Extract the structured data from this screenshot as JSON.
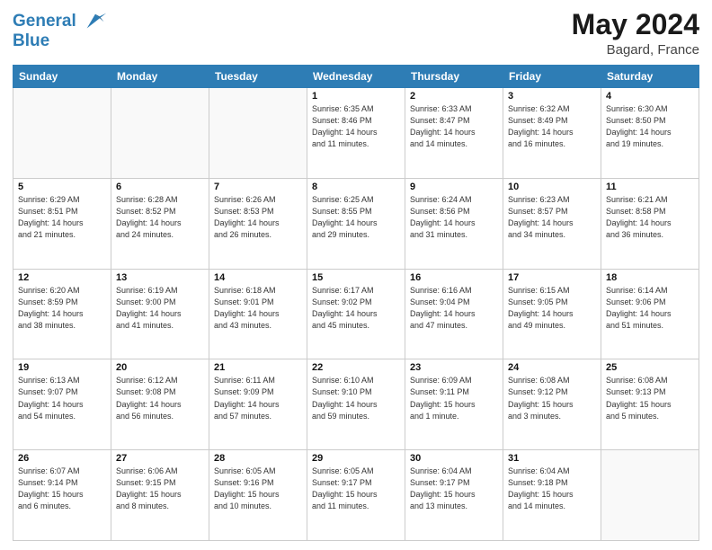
{
  "logo": {
    "line1": "General",
    "line2": "Blue"
  },
  "title": "May 2024",
  "subtitle": "Bagard, France",
  "days_of_week": [
    "Sunday",
    "Monday",
    "Tuesday",
    "Wednesday",
    "Thursday",
    "Friday",
    "Saturday"
  ],
  "weeks": [
    [
      {
        "day": "",
        "info": ""
      },
      {
        "day": "",
        "info": ""
      },
      {
        "day": "",
        "info": ""
      },
      {
        "day": "1",
        "info": "Sunrise: 6:35 AM\nSunset: 8:46 PM\nDaylight: 14 hours\nand 11 minutes."
      },
      {
        "day": "2",
        "info": "Sunrise: 6:33 AM\nSunset: 8:47 PM\nDaylight: 14 hours\nand 14 minutes."
      },
      {
        "day": "3",
        "info": "Sunrise: 6:32 AM\nSunset: 8:49 PM\nDaylight: 14 hours\nand 16 minutes."
      },
      {
        "day": "4",
        "info": "Sunrise: 6:30 AM\nSunset: 8:50 PM\nDaylight: 14 hours\nand 19 minutes."
      }
    ],
    [
      {
        "day": "5",
        "info": "Sunrise: 6:29 AM\nSunset: 8:51 PM\nDaylight: 14 hours\nand 21 minutes."
      },
      {
        "day": "6",
        "info": "Sunrise: 6:28 AM\nSunset: 8:52 PM\nDaylight: 14 hours\nand 24 minutes."
      },
      {
        "day": "7",
        "info": "Sunrise: 6:26 AM\nSunset: 8:53 PM\nDaylight: 14 hours\nand 26 minutes."
      },
      {
        "day": "8",
        "info": "Sunrise: 6:25 AM\nSunset: 8:55 PM\nDaylight: 14 hours\nand 29 minutes."
      },
      {
        "day": "9",
        "info": "Sunrise: 6:24 AM\nSunset: 8:56 PM\nDaylight: 14 hours\nand 31 minutes."
      },
      {
        "day": "10",
        "info": "Sunrise: 6:23 AM\nSunset: 8:57 PM\nDaylight: 14 hours\nand 34 minutes."
      },
      {
        "day": "11",
        "info": "Sunrise: 6:21 AM\nSunset: 8:58 PM\nDaylight: 14 hours\nand 36 minutes."
      }
    ],
    [
      {
        "day": "12",
        "info": "Sunrise: 6:20 AM\nSunset: 8:59 PM\nDaylight: 14 hours\nand 38 minutes."
      },
      {
        "day": "13",
        "info": "Sunrise: 6:19 AM\nSunset: 9:00 PM\nDaylight: 14 hours\nand 41 minutes."
      },
      {
        "day": "14",
        "info": "Sunrise: 6:18 AM\nSunset: 9:01 PM\nDaylight: 14 hours\nand 43 minutes."
      },
      {
        "day": "15",
        "info": "Sunrise: 6:17 AM\nSunset: 9:02 PM\nDaylight: 14 hours\nand 45 minutes."
      },
      {
        "day": "16",
        "info": "Sunrise: 6:16 AM\nSunset: 9:04 PM\nDaylight: 14 hours\nand 47 minutes."
      },
      {
        "day": "17",
        "info": "Sunrise: 6:15 AM\nSunset: 9:05 PM\nDaylight: 14 hours\nand 49 minutes."
      },
      {
        "day": "18",
        "info": "Sunrise: 6:14 AM\nSunset: 9:06 PM\nDaylight: 14 hours\nand 51 minutes."
      }
    ],
    [
      {
        "day": "19",
        "info": "Sunrise: 6:13 AM\nSunset: 9:07 PM\nDaylight: 14 hours\nand 54 minutes."
      },
      {
        "day": "20",
        "info": "Sunrise: 6:12 AM\nSunset: 9:08 PM\nDaylight: 14 hours\nand 56 minutes."
      },
      {
        "day": "21",
        "info": "Sunrise: 6:11 AM\nSunset: 9:09 PM\nDaylight: 14 hours\nand 57 minutes."
      },
      {
        "day": "22",
        "info": "Sunrise: 6:10 AM\nSunset: 9:10 PM\nDaylight: 14 hours\nand 59 minutes."
      },
      {
        "day": "23",
        "info": "Sunrise: 6:09 AM\nSunset: 9:11 PM\nDaylight: 15 hours\nand 1 minute."
      },
      {
        "day": "24",
        "info": "Sunrise: 6:08 AM\nSunset: 9:12 PM\nDaylight: 15 hours\nand 3 minutes."
      },
      {
        "day": "25",
        "info": "Sunrise: 6:08 AM\nSunset: 9:13 PM\nDaylight: 15 hours\nand 5 minutes."
      }
    ],
    [
      {
        "day": "26",
        "info": "Sunrise: 6:07 AM\nSunset: 9:14 PM\nDaylight: 15 hours\nand 6 minutes."
      },
      {
        "day": "27",
        "info": "Sunrise: 6:06 AM\nSunset: 9:15 PM\nDaylight: 15 hours\nand 8 minutes."
      },
      {
        "day": "28",
        "info": "Sunrise: 6:05 AM\nSunset: 9:16 PM\nDaylight: 15 hours\nand 10 minutes."
      },
      {
        "day": "29",
        "info": "Sunrise: 6:05 AM\nSunset: 9:17 PM\nDaylight: 15 hours\nand 11 minutes."
      },
      {
        "day": "30",
        "info": "Sunrise: 6:04 AM\nSunset: 9:17 PM\nDaylight: 15 hours\nand 13 minutes."
      },
      {
        "day": "31",
        "info": "Sunrise: 6:04 AM\nSunset: 9:18 PM\nDaylight: 15 hours\nand 14 minutes."
      },
      {
        "day": "",
        "info": ""
      }
    ]
  ]
}
